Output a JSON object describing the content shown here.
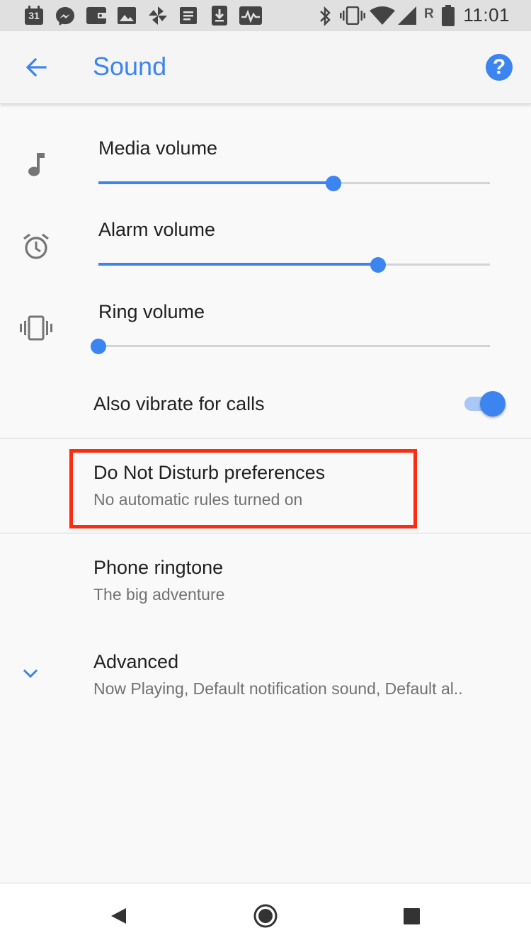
{
  "status_bar": {
    "time": "11:01",
    "network_label": "R",
    "calendar_day": "31",
    "notification_icons": [
      "calendar-icon",
      "messenger-icon",
      "wallet-icon",
      "photos-icon",
      "pinwheel-icon",
      "docs-icon",
      "download-icon",
      "activity-icon"
    ],
    "system_icons": [
      "bluetooth-icon",
      "vibrate-icon",
      "wifi-icon",
      "signal-icon",
      "battery-icon"
    ]
  },
  "app_bar": {
    "title": "Sound",
    "back_icon": "arrow-back-icon",
    "help_icon": "help-icon",
    "help_glyph": "?"
  },
  "volumes": [
    {
      "label": "Media volume",
      "icon": "music-note-icon",
      "level": 0.6
    },
    {
      "label": "Alarm volume",
      "icon": "alarm-clock-icon",
      "level": 0.715
    },
    {
      "label": "Ring volume",
      "icon": "vibrate-icon",
      "level": 0.0
    }
  ],
  "vibrate": {
    "label": "Also vibrate for calls",
    "on": true
  },
  "dnd": {
    "title": "Do Not Disturb preferences",
    "summary": "No automatic rules turned on"
  },
  "ringtone": {
    "title": "Phone ringtone",
    "summary": "The big adventure"
  },
  "advanced": {
    "title": "Advanced",
    "summary": "Now Playing, Default notification sound, Default al..",
    "icon": "chevron-down-icon"
  },
  "nav": {
    "back_icon": "nav-back-icon",
    "home_icon": "nav-home-icon",
    "recents_icon": "nav-recents-icon"
  },
  "colors": {
    "accent": "#3c84f0",
    "highlight": "#ff2a0f",
    "text_primary": "#212121",
    "text_secondary": "#727272"
  }
}
